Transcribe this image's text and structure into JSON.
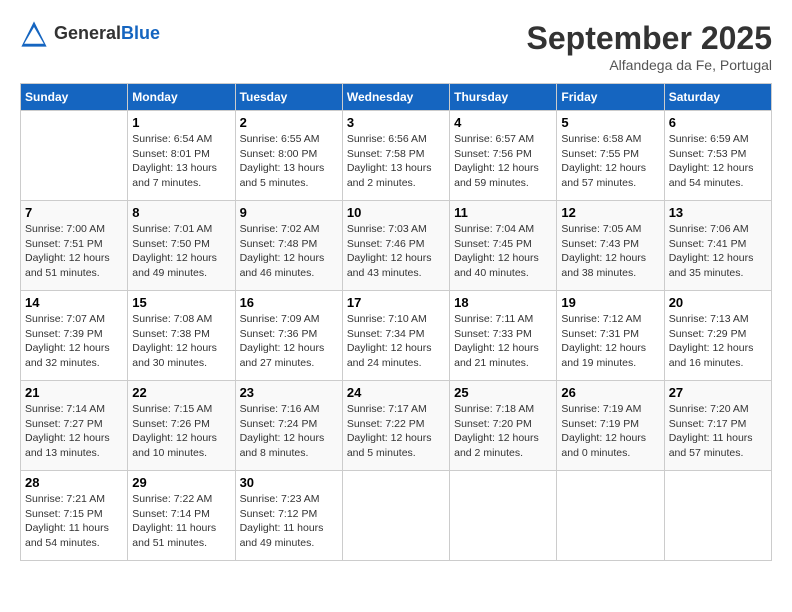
{
  "header": {
    "logo_general": "General",
    "logo_blue": "Blue",
    "month_title": "September 2025",
    "subtitle": "Alfandega da Fe, Portugal"
  },
  "weekdays": [
    "Sunday",
    "Monday",
    "Tuesday",
    "Wednesday",
    "Thursday",
    "Friday",
    "Saturday"
  ],
  "weeks": [
    [
      {
        "day": "",
        "text": ""
      },
      {
        "day": "1",
        "text": "Sunrise: 6:54 AM\nSunset: 8:01 PM\nDaylight: 13 hours\nand 7 minutes."
      },
      {
        "day": "2",
        "text": "Sunrise: 6:55 AM\nSunset: 8:00 PM\nDaylight: 13 hours\nand 5 minutes."
      },
      {
        "day": "3",
        "text": "Sunrise: 6:56 AM\nSunset: 7:58 PM\nDaylight: 13 hours\nand 2 minutes."
      },
      {
        "day": "4",
        "text": "Sunrise: 6:57 AM\nSunset: 7:56 PM\nDaylight: 12 hours\nand 59 minutes."
      },
      {
        "day": "5",
        "text": "Sunrise: 6:58 AM\nSunset: 7:55 PM\nDaylight: 12 hours\nand 57 minutes."
      },
      {
        "day": "6",
        "text": "Sunrise: 6:59 AM\nSunset: 7:53 PM\nDaylight: 12 hours\nand 54 minutes."
      }
    ],
    [
      {
        "day": "7",
        "text": "Sunrise: 7:00 AM\nSunset: 7:51 PM\nDaylight: 12 hours\nand 51 minutes."
      },
      {
        "day": "8",
        "text": "Sunrise: 7:01 AM\nSunset: 7:50 PM\nDaylight: 12 hours\nand 49 minutes."
      },
      {
        "day": "9",
        "text": "Sunrise: 7:02 AM\nSunset: 7:48 PM\nDaylight: 12 hours\nand 46 minutes."
      },
      {
        "day": "10",
        "text": "Sunrise: 7:03 AM\nSunset: 7:46 PM\nDaylight: 12 hours\nand 43 minutes."
      },
      {
        "day": "11",
        "text": "Sunrise: 7:04 AM\nSunset: 7:45 PM\nDaylight: 12 hours\nand 40 minutes."
      },
      {
        "day": "12",
        "text": "Sunrise: 7:05 AM\nSunset: 7:43 PM\nDaylight: 12 hours\nand 38 minutes."
      },
      {
        "day": "13",
        "text": "Sunrise: 7:06 AM\nSunset: 7:41 PM\nDaylight: 12 hours\nand 35 minutes."
      }
    ],
    [
      {
        "day": "14",
        "text": "Sunrise: 7:07 AM\nSunset: 7:39 PM\nDaylight: 12 hours\nand 32 minutes."
      },
      {
        "day": "15",
        "text": "Sunrise: 7:08 AM\nSunset: 7:38 PM\nDaylight: 12 hours\nand 30 minutes."
      },
      {
        "day": "16",
        "text": "Sunrise: 7:09 AM\nSunset: 7:36 PM\nDaylight: 12 hours\nand 27 minutes."
      },
      {
        "day": "17",
        "text": "Sunrise: 7:10 AM\nSunset: 7:34 PM\nDaylight: 12 hours\nand 24 minutes."
      },
      {
        "day": "18",
        "text": "Sunrise: 7:11 AM\nSunset: 7:33 PM\nDaylight: 12 hours\nand 21 minutes."
      },
      {
        "day": "19",
        "text": "Sunrise: 7:12 AM\nSunset: 7:31 PM\nDaylight: 12 hours\nand 19 minutes."
      },
      {
        "day": "20",
        "text": "Sunrise: 7:13 AM\nSunset: 7:29 PM\nDaylight: 12 hours\nand 16 minutes."
      }
    ],
    [
      {
        "day": "21",
        "text": "Sunrise: 7:14 AM\nSunset: 7:27 PM\nDaylight: 12 hours\nand 13 minutes."
      },
      {
        "day": "22",
        "text": "Sunrise: 7:15 AM\nSunset: 7:26 PM\nDaylight: 12 hours\nand 10 minutes."
      },
      {
        "day": "23",
        "text": "Sunrise: 7:16 AM\nSunset: 7:24 PM\nDaylight: 12 hours\nand 8 minutes."
      },
      {
        "day": "24",
        "text": "Sunrise: 7:17 AM\nSunset: 7:22 PM\nDaylight: 12 hours\nand 5 minutes."
      },
      {
        "day": "25",
        "text": "Sunrise: 7:18 AM\nSunset: 7:20 PM\nDaylight: 12 hours\nand 2 minutes."
      },
      {
        "day": "26",
        "text": "Sunrise: 7:19 AM\nSunset: 7:19 PM\nDaylight: 12 hours\nand 0 minutes."
      },
      {
        "day": "27",
        "text": "Sunrise: 7:20 AM\nSunset: 7:17 PM\nDaylight: 11 hours\nand 57 minutes."
      }
    ],
    [
      {
        "day": "28",
        "text": "Sunrise: 7:21 AM\nSunset: 7:15 PM\nDaylight: 11 hours\nand 54 minutes."
      },
      {
        "day": "29",
        "text": "Sunrise: 7:22 AM\nSunset: 7:14 PM\nDaylight: 11 hours\nand 51 minutes."
      },
      {
        "day": "30",
        "text": "Sunrise: 7:23 AM\nSunset: 7:12 PM\nDaylight: 11 hours\nand 49 minutes."
      },
      {
        "day": "",
        "text": ""
      },
      {
        "day": "",
        "text": ""
      },
      {
        "day": "",
        "text": ""
      },
      {
        "day": "",
        "text": ""
      }
    ]
  ]
}
